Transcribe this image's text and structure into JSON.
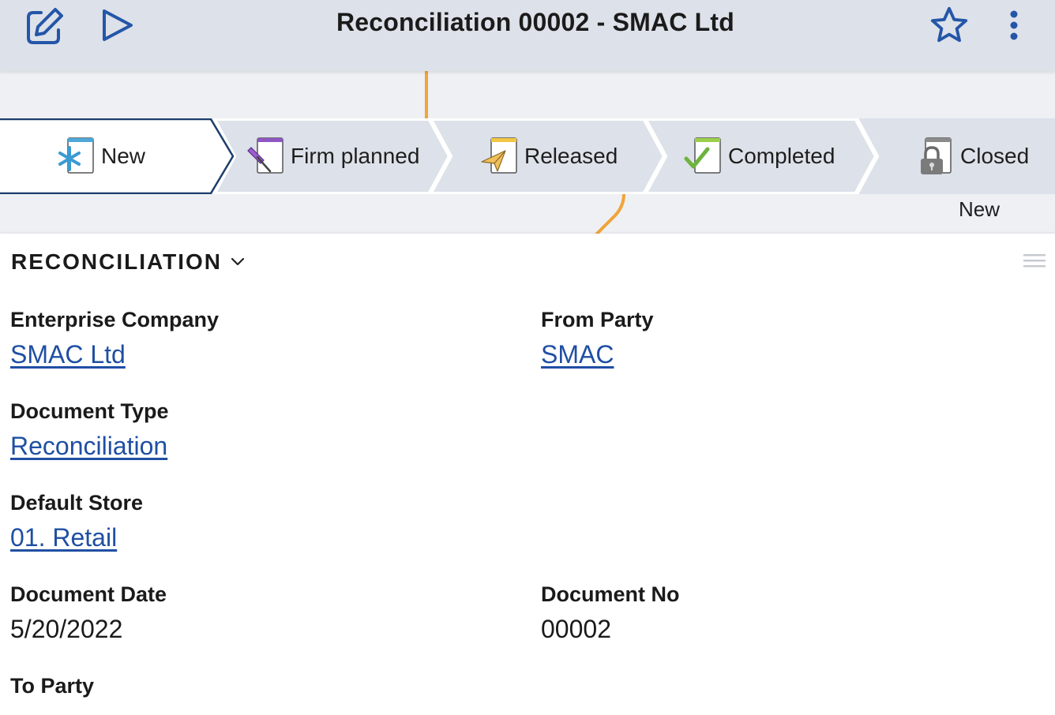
{
  "header": {
    "title": "Reconciliation 00002 - SMAC Ltd",
    "edit_icon": "edit-icon",
    "run_icon": "play-icon",
    "favorite_icon": "star-icon",
    "more_icon": "more-vertical-icon"
  },
  "status_steps": [
    {
      "label": "New",
      "icon": "asterisk-doc-icon",
      "active": true
    },
    {
      "label": "Firm planned",
      "icon": "pin-doc-icon",
      "active": false
    },
    {
      "label": "Released",
      "icon": "paper-plane-doc-icon",
      "active": false
    },
    {
      "label": "Completed",
      "icon": "check-doc-icon",
      "active": false
    },
    {
      "label": "Closed",
      "icon": "lock-doc-icon",
      "active": false
    }
  ],
  "status_current": "New",
  "section": {
    "title": "RECONCILIATION",
    "fields": {
      "enterprise_company": {
        "label": "Enterprise Company",
        "value": "SMAC Ltd"
      },
      "from_party": {
        "label": "From Party",
        "value": "SMAC"
      },
      "document_type": {
        "label": "Document Type",
        "value": "Reconciliation"
      },
      "default_store": {
        "label": "Default Store",
        "value": "01. Retail"
      },
      "document_date": {
        "label": "Document Date",
        "value": "5/20/2022"
      },
      "document_no": {
        "label": "Document No",
        "value": "00002"
      },
      "to_party": {
        "label": "To Party",
        "value": ""
      }
    }
  },
  "colors": {
    "accent": "#2456a8",
    "link": "#1f4fa3",
    "topbar_bg": "#dde1e9",
    "step_bg": "#dde1e9",
    "active_step_bg": "#ffffff",
    "step_border": "#1d3d6b"
  }
}
